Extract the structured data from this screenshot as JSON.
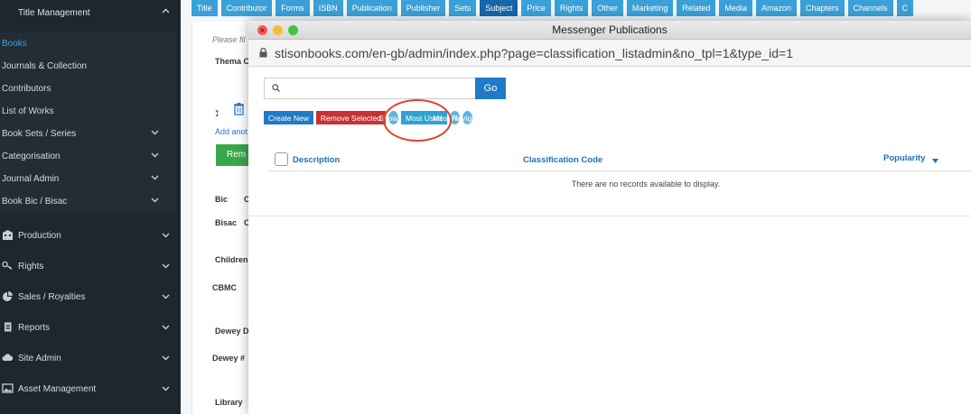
{
  "sidebar": {
    "top_item": "Title Management",
    "items": [
      {
        "label": "Books",
        "active": true,
        "chevron": false
      },
      {
        "label": "Journals & Collection",
        "chevron": false
      },
      {
        "label": "Contributors",
        "chevron": false
      },
      {
        "label": "List of Works",
        "chevron": false
      },
      {
        "label": "Book Sets / Series",
        "chevron": true
      },
      {
        "label": "Categorisation",
        "chevron": true
      },
      {
        "label": "Journal Admin",
        "chevron": true
      },
      {
        "label": "Book Bic / Bisac",
        "chevron": true
      }
    ],
    "sections": [
      {
        "label": "Production",
        "icon": "building-icon"
      },
      {
        "label": "Rights",
        "icon": "key-icon"
      },
      {
        "label": "Sales / Royalties",
        "icon": "pie-chart-icon"
      },
      {
        "label": "Reports",
        "icon": "document-icon"
      },
      {
        "label": "Site Admin",
        "icon": "cloud-icon"
      },
      {
        "label": "Asset Management",
        "icon": "image-icon"
      }
    ]
  },
  "tabs": [
    "Title",
    "Contributor",
    "Forms",
    "ISBN",
    "Publication",
    "Publisher",
    "Sets",
    "Subject",
    "Price",
    "Rights",
    "Other",
    "Marketing",
    "Related",
    "Media",
    "Amazon",
    "Chapters",
    "Channels",
    "C"
  ],
  "active_tab": "Subject",
  "background_page": {
    "please_note": "Please fil",
    "thema": "Thema C",
    "add_another": "Add anot",
    "green_button": "Rem",
    "bic": "Bic",
    "bic_c": "C",
    "bisac": "Bisac",
    "bisac_c": "C",
    "children": "Children",
    "cbmc": "CBMC",
    "dewey": "Dewey D",
    "dewey_num": "Dewey #",
    "library": "Library"
  },
  "modal": {
    "window_title": "Messenger Publications",
    "url": "stisonbooks.com/en-gb/admin/index.php?page=classification_listadmin&no_tpl=1&type_id=1",
    "search_placeholder": "",
    "go_label": "Go",
    "actions": {
      "create_new": "Create New",
      "remove_selected": "Remove Selected",
      "show_all": "Show All",
      "most_used": "Most Used",
      "most_recent": "Most Recent",
      "navigate": "Navigate"
    },
    "table": {
      "columns": [
        "Description",
        "Classification Code",
        "Popularity"
      ],
      "empty_message": "There are no records available to display."
    }
  },
  "colors": {
    "sidebar_bg": "#1e2730",
    "accent_blue": "#1f7ac8",
    "tab_blue": "#3aa0d8",
    "active_tab": "#1565a8",
    "danger_red": "#c83232",
    "highlight_ring": "#e0402a"
  }
}
